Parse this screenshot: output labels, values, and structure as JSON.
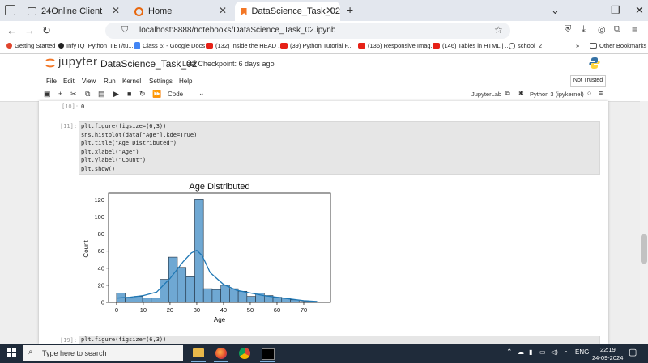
{
  "browser": {
    "tabs": [
      {
        "label": "24Online Client",
        "active": false
      },
      {
        "label": "Home",
        "active": false
      },
      {
        "label": "DataScience_Task_02",
        "active": true
      }
    ],
    "new_tab": "+",
    "url": "localhost:8888/notebooks/DataScience_Task_02.ipynb",
    "bookmarks": [
      "Getting Started",
      "InfyTQ_Python_IIET/tu...",
      "Class 5: - Google Docs",
      "(132) Inside the HEAD ...",
      "(39) Python Tutorial F...",
      "(136) Responsive Imag...",
      "(146) Tables in HTML | ...",
      "school_2",
      "Other Bookmarks"
    ]
  },
  "jupyter": {
    "logo": "jupyter",
    "notebook_title": "DataScience_Task_02",
    "checkpoint": "Last Checkpoint: 6 days ago",
    "menus": [
      "File",
      "Edit",
      "View",
      "Run",
      "Kernel",
      "Settings",
      "Help"
    ],
    "trust": "Not Trusted",
    "cell_type": "Code",
    "jupyterlab_link": "JupyterLab",
    "kernel": "Python 3 (ipykernel)"
  },
  "cells": {
    "prev_prompt": "[10]:",
    "prev_output": "0",
    "cell11_prompt": "[11]:",
    "cell11_lines": [
      "plt.figure(figsize=(6,3))",
      "sns.histplot(data[\"Age\"],kde=True)",
      "plt.title(\"Age Distributed\")",
      "plt.xlabel(\"Age\")",
      "plt.ylabel(\"Count\")",
      "plt.show()"
    ],
    "cell19_prompt": "[19]:",
    "cell19_line": "plt.figure(figsize=(6,3))"
  },
  "chart_data": {
    "type": "bar",
    "title": "Age Distributed",
    "xlabel": "Age",
    "ylabel": "Count",
    "xlim": [
      -3,
      80
    ],
    "ylim": [
      0,
      128
    ],
    "xticks": [
      0,
      10,
      20,
      30,
      40,
      50,
      60,
      70
    ],
    "yticks": [
      0,
      20,
      40,
      60,
      80,
      100,
      120
    ],
    "bin_edges": [
      0,
      3.25,
      6.5,
      9.75,
      13,
      16.25,
      19.5,
      22.75,
      26,
      29.25,
      32.5,
      35.75,
      39,
      42.25,
      45.5,
      48.75,
      52,
      55.25,
      58.5,
      61.75,
      65,
      68.25,
      71.5,
      74.75
    ],
    "counts": [
      11,
      5,
      7,
      5,
      5,
      27,
      53,
      41,
      30,
      121,
      16,
      15,
      20,
      16,
      13,
      7,
      11,
      8,
      6,
      5,
      3,
      1,
      1
    ],
    "kde": [
      [
        0,
        5
      ],
      [
        5,
        6
      ],
      [
        10,
        8
      ],
      [
        15,
        12
      ],
      [
        20,
        28
      ],
      [
        25,
        48
      ],
      [
        28,
        58
      ],
      [
        30,
        61
      ],
      [
        32,
        55
      ],
      [
        35,
        35
      ],
      [
        40,
        21
      ],
      [
        45,
        14
      ],
      [
        50,
        11
      ],
      [
        55,
        8
      ],
      [
        60,
        6
      ],
      [
        65,
        4
      ],
      [
        70,
        2
      ],
      [
        75,
        1
      ]
    ],
    "bar_color": "#6fa8d3",
    "edge_color": "#1f2f3f",
    "kde_color": "#1f77b4"
  },
  "taskbar": {
    "search_placeholder": "Type here to search",
    "lang": "ENG",
    "time": "22:19",
    "date": "24-09-2024"
  }
}
